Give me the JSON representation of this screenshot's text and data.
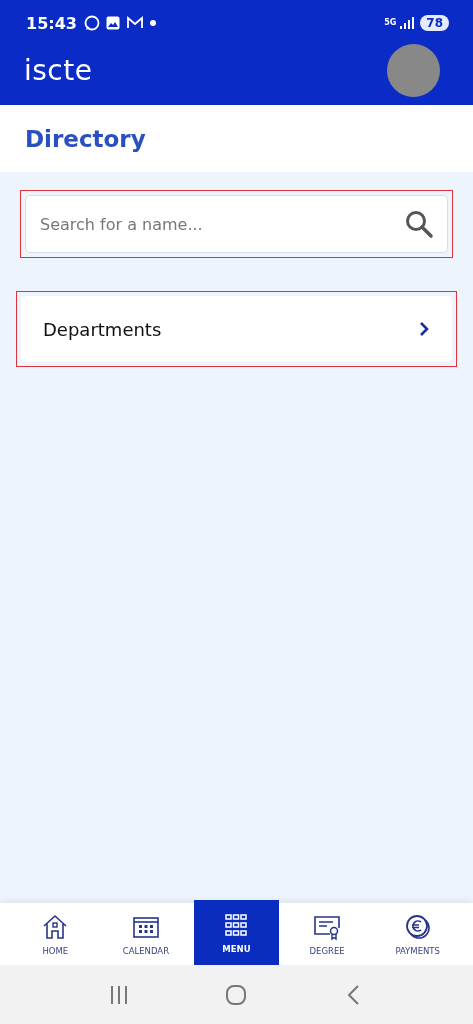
{
  "status_bar": {
    "time": "15:43",
    "network": "5G",
    "battery": "78"
  },
  "header": {
    "logo": "iscte"
  },
  "title": "Directory",
  "search": {
    "placeholder": "Search for a name...",
    "highlighted": true
  },
  "items": [
    {
      "label": "Departments",
      "highlighted": true
    }
  ],
  "bottom_nav": [
    {
      "label": "HOME",
      "kind": "home",
      "selected": false
    },
    {
      "label": "CALENDAR",
      "kind": "calendar",
      "selected": false
    },
    {
      "label": "MENU",
      "kind": "grid",
      "selected": true
    },
    {
      "label": "DEGREE",
      "kind": "certificate",
      "selected": false
    },
    {
      "label": "PAYMENTS",
      "kind": "coin",
      "selected": false
    }
  ]
}
